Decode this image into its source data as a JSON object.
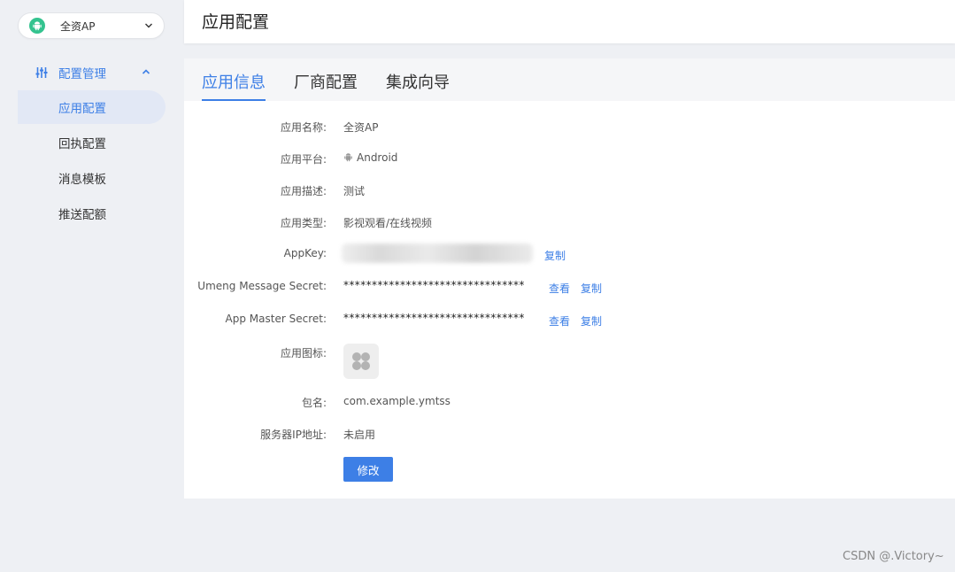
{
  "app_selector": {
    "name": "全资AP"
  },
  "sidebar": {
    "group_label": "配置管理",
    "items": [
      {
        "label": "应用配置",
        "active": true
      },
      {
        "label": "回执配置",
        "active": false
      },
      {
        "label": "消息模板",
        "active": false
      },
      {
        "label": "推送配额",
        "active": false
      }
    ]
  },
  "header": {
    "title": "应用配置"
  },
  "tabs": [
    {
      "label": "应用信息",
      "active": true
    },
    {
      "label": "厂商配置",
      "active": false
    },
    {
      "label": "集成向导",
      "active": false
    }
  ],
  "fields": {
    "app_name": {
      "label": "应用名称:",
      "value": "全资AP"
    },
    "platform": {
      "label": "应用平台:",
      "value": "Android"
    },
    "description": {
      "label": "应用描述:",
      "value": "测试"
    },
    "app_type": {
      "label": "应用类型:",
      "value": "影视观看/在线视频"
    },
    "app_key": {
      "label": "AppKey:",
      "value": "",
      "copy": "复制"
    },
    "umeng_secret": {
      "label": "Umeng Message Secret:",
      "value": "********************************",
      "view": "查看",
      "copy": "复制"
    },
    "master_secret": {
      "label": "App Master Secret:",
      "value": "********************************",
      "view": "查看",
      "copy": "复制"
    },
    "app_icon": {
      "label": "应用图标:"
    },
    "package": {
      "label": "包名:",
      "value": "com.example.ymtss"
    },
    "server_ip": {
      "label": "服务器IP地址:",
      "value": "未启用"
    }
  },
  "edit_button": "修改",
  "watermark": "CSDN @.Victory~",
  "colors": {
    "accent": "#3d7fe6",
    "android_green": "#34c38f",
    "background": "#eef0f4"
  }
}
